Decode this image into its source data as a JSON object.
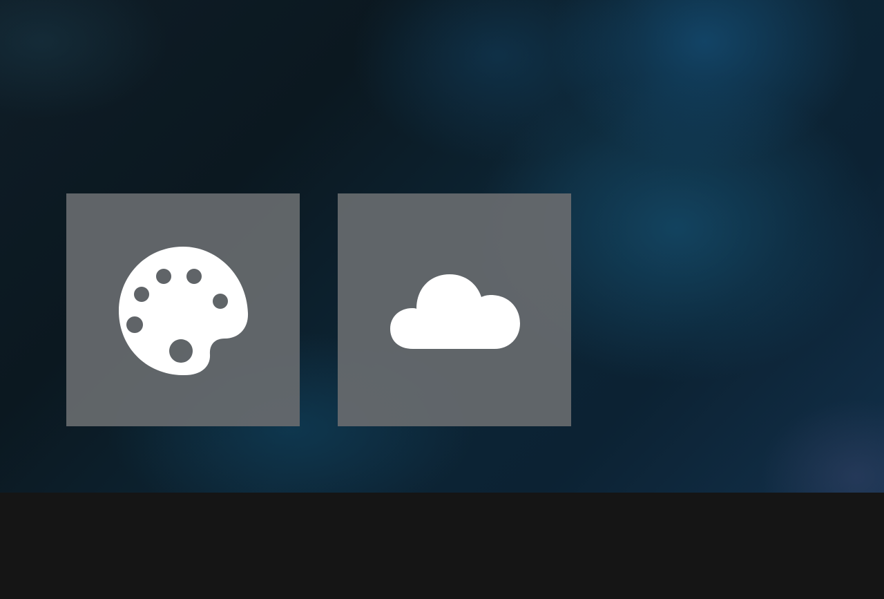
{
  "colors": {
    "tile_background": "#65696c",
    "taskbar": "#151515",
    "icon": "#ffffff"
  },
  "tiles": [
    {
      "icon": "palette-icon"
    },
    {
      "icon": "cloud-icon"
    }
  ]
}
